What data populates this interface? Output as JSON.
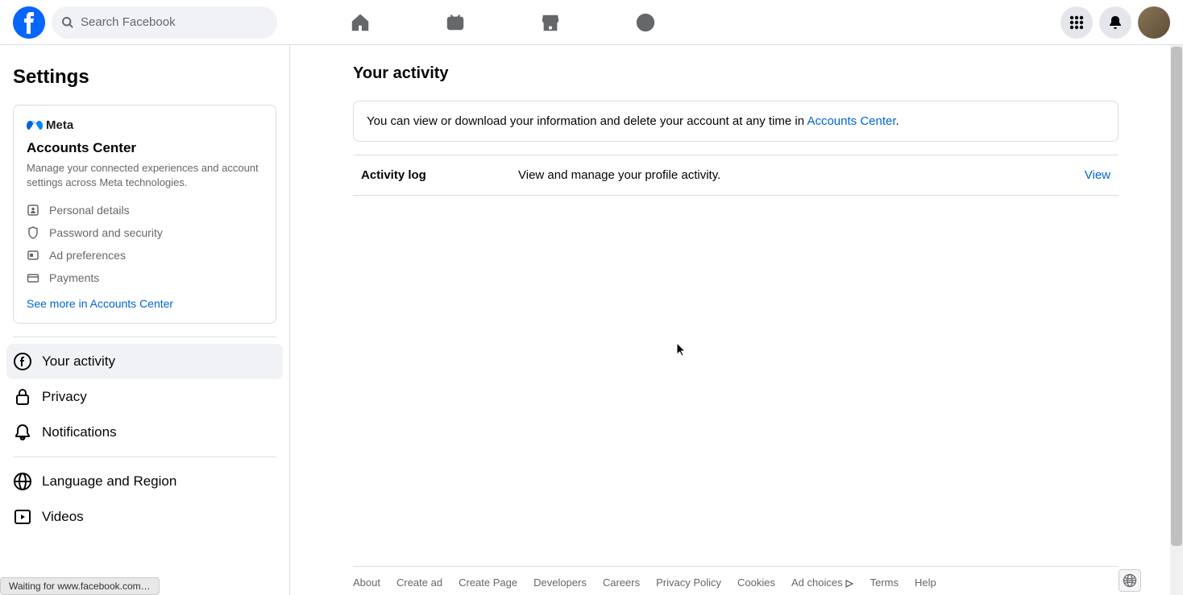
{
  "search": {
    "placeholder": "Search Facebook"
  },
  "sidebar": {
    "title": "Settings",
    "accounts_card": {
      "brand": "Meta",
      "title": "Accounts Center",
      "description": "Manage your connected experiences and account settings across Meta technologies.",
      "items": [
        {
          "icon": "personal-details-icon",
          "label": "Personal details"
        },
        {
          "icon": "shield-icon",
          "label": "Password and security"
        },
        {
          "icon": "ad-preferences-icon",
          "label": "Ad preferences"
        },
        {
          "icon": "payments-icon",
          "label": "Payments"
        }
      ],
      "link": "See more in Accounts Center"
    },
    "nav": [
      {
        "icon": "facebook-circle-icon",
        "label": "Your activity",
        "active": true
      },
      {
        "icon": "lock-icon",
        "label": "Privacy",
        "active": false
      },
      {
        "icon": "bell-icon",
        "label": "Notifications",
        "active": false
      },
      {
        "icon": "globe-icon",
        "label": "Language and Region",
        "active": false
      },
      {
        "icon": "video-play-icon",
        "label": "Videos",
        "active": false
      }
    ]
  },
  "content": {
    "title": "Your activity",
    "banner_text": "You can view or download your information and delete your account at any time in ",
    "banner_link": "Accounts Center",
    "banner_suffix": ".",
    "activity_log": {
      "title": "Activity log",
      "description": "View and manage your profile activity.",
      "action": "View"
    }
  },
  "footer": {
    "links": [
      "About",
      "Create ad",
      "Create Page",
      "Developers",
      "Careers",
      "Privacy Policy",
      "Cookies",
      "Ad choices",
      "Terms",
      "Help"
    ]
  },
  "status": "Waiting for www.facebook.com…",
  "colors": {
    "primary_blue": "#0866ff",
    "link_blue": "#0064d1",
    "text_primary": "#050505",
    "text_secondary": "#65676b",
    "bg_gray": "#f0f2f5",
    "border": "#dddddd"
  }
}
